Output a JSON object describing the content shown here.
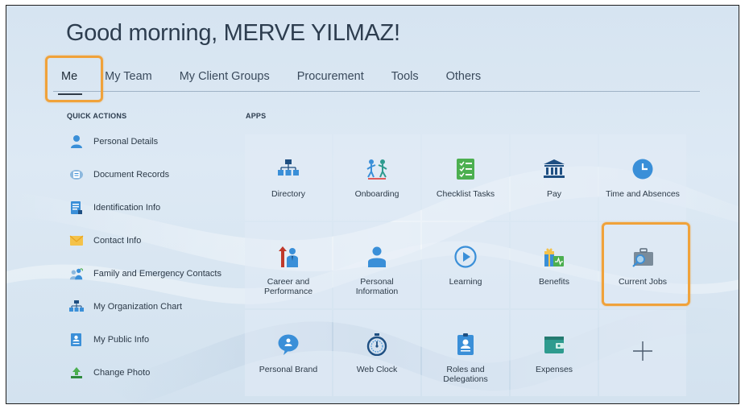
{
  "greeting": "Good morning, MERVE YILMAZ!",
  "tabs": [
    {
      "label": "Me"
    },
    {
      "label": "My Team"
    },
    {
      "label": "My Client Groups"
    },
    {
      "label": "Procurement"
    },
    {
      "label": "Tools"
    },
    {
      "label": "Others"
    }
  ],
  "quick_actions": {
    "title": "QUICK ACTIONS",
    "items": [
      {
        "label": "Personal Details",
        "icon": "person-icon"
      },
      {
        "label": "Document Records",
        "icon": "document-records-icon"
      },
      {
        "label": "Identification Info",
        "icon": "id-card-icon"
      },
      {
        "label": "Contact Info",
        "icon": "envelope-icon"
      },
      {
        "label": "Family and Emergency Contacts",
        "icon": "family-icon"
      },
      {
        "label": "My Organization Chart",
        "icon": "org-chart-icon"
      },
      {
        "label": "My Public Info",
        "icon": "public-info-icon"
      },
      {
        "label": "Change Photo",
        "icon": "upload-icon"
      }
    ]
  },
  "apps": {
    "title": "APPS",
    "items": [
      {
        "label": "Directory",
        "icon": "directory-icon"
      },
      {
        "label": "Onboarding",
        "icon": "onboarding-icon"
      },
      {
        "label": "Checklist Tasks",
        "icon": "checklist-icon"
      },
      {
        "label": "Pay",
        "icon": "bank-icon"
      },
      {
        "label": "Time and Absences",
        "icon": "clock-icon"
      },
      {
        "label": "Career and Performance",
        "icon": "career-icon"
      },
      {
        "label": "Personal Information",
        "icon": "person-icon"
      },
      {
        "label": "Learning",
        "icon": "play-icon"
      },
      {
        "label": "Benefits",
        "icon": "gift-icon"
      },
      {
        "label": "Current Jobs",
        "icon": "briefcase-search-icon"
      },
      {
        "label": "Personal Brand",
        "icon": "chat-bubble-icon"
      },
      {
        "label": "Web Clock",
        "icon": "stopwatch-icon"
      },
      {
        "label": "Roles and Delegations",
        "icon": "badge-icon"
      },
      {
        "label": "Expenses",
        "icon": "wallet-icon"
      },
      {
        "label": "",
        "icon": "plus-icon"
      }
    ]
  },
  "colors": {
    "highlight": "#f0a23a",
    "icon_blue": "#3a8fd8",
    "icon_green": "#4caf50",
    "icon_teal": "#2e9b8f",
    "icon_dark_blue": "#1e4f82"
  }
}
